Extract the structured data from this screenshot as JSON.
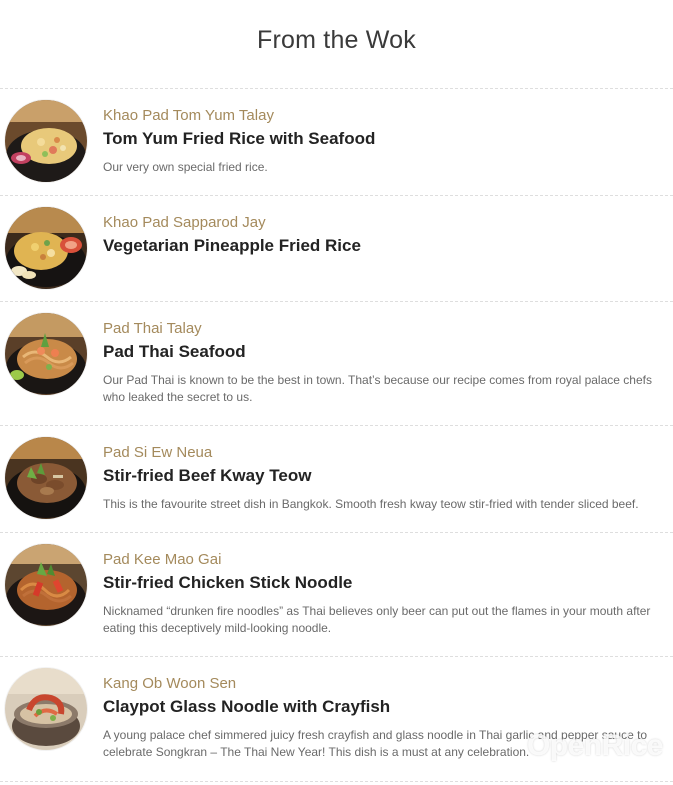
{
  "page": {
    "title": "From the Wok",
    "watermark": "OpenRice"
  },
  "colors": {
    "thai_name": "#a48a5c",
    "english_name": "#232323",
    "description": "#6a6a6a",
    "divider": "#dedede"
  },
  "menu": {
    "items": [
      {
        "thai_name": "Khao Pad Tom Yum Talay",
        "english_name": "Tom Yum Fried Rice with Seafood",
        "description": "Our very own special fried rice.",
        "icon": "fried-rice-seafood-photo"
      },
      {
        "thai_name": "Khao Pad Sapparod Jay",
        "english_name": "Vegetarian Pineapple Fried Rice",
        "description": "",
        "icon": "pineapple-fried-rice-photo"
      },
      {
        "thai_name": "Pad Thai Talay",
        "english_name": "Pad Thai Seafood",
        "description": "Our Pad Thai is known to be the best in town. That’s because our recipe comes from royal palace chefs who leaked the secret to us.",
        "icon": "pad-thai-photo"
      },
      {
        "thai_name": "Pad Si Ew Neua",
        "english_name": "Stir-fried Beef Kway Teow",
        "description": "This is the favourite street dish in Bangkok. Smooth fresh kway teow stir-fried with tender sliced beef.",
        "icon": "beef-kway-teow-photo"
      },
      {
        "thai_name": "Pad Kee Mao Gai",
        "english_name": "Stir-fried Chicken Stick Noodle",
        "description": "Nicknamed “drunken fire noodles” as Thai believes only beer can put out the flames in your mouth after eating this deceptively mild-looking noodle.",
        "icon": "chicken-stick-noodle-photo"
      },
      {
        "thai_name": "Kang Ob Woon Sen",
        "english_name": "Claypot Glass Noodle with Crayfish",
        "description": "A young palace chef simmered juicy fresh crayfish and glass noodle in Thai garlic and pepper sauce to celebrate Songkran – The Thai New Year! This dish is a must at any celebration.",
        "icon": "claypot-noodle-crayfish-photo"
      }
    ]
  }
}
